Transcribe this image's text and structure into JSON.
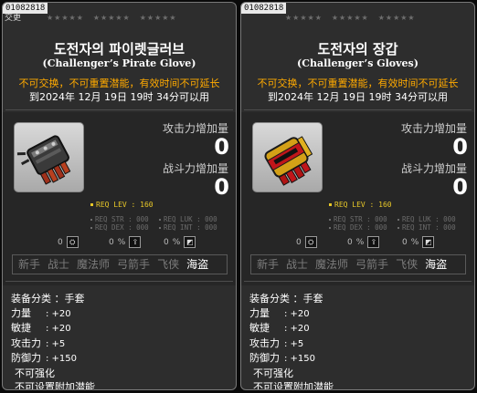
{
  "cards": [
    {
      "id": "01082818",
      "subtitle": "交更",
      "stars": [
        "★★★★★",
        "★★★★★",
        "★★★★★"
      ],
      "name_ko": "도전자의 파이렛글러브",
      "name_en": "(Challenger’s Pirate Glove)",
      "restriction": "不可交换，不可重置潜能，有效时间不可延长",
      "expiry": "到2024年 12月 19日 19时 34分可以用",
      "icon": "pirate-glove-icon",
      "attack_label": "攻击力增加量",
      "attack_value": "0",
      "combat_label": "战斗力增加量",
      "combat_value": "0",
      "req_lev": "REQ LEV : 160",
      "req_str": "REQ STR : 000",
      "req_luk": "REQ LUK : 000",
      "req_dex": "REQ DEX : 000",
      "req_int": "REQ INT : 000",
      "pct": [
        {
          "val": "0",
          "sym": "%"
        },
        {
          "val": "0",
          "sym": "%"
        },
        {
          "val": "0",
          "sym": "%"
        }
      ],
      "jobs": [
        "新手",
        "战士",
        "魔法师",
        "弓箭手",
        "飞侠",
        "海盗"
      ],
      "active_job": "海盗",
      "category_label": "装备分类",
      "category_value": "：手套",
      "stats": [
        {
          "label": "力量",
          "value": ": +20"
        },
        {
          "label": "敏捷",
          "value": ": +20"
        },
        {
          "label": "攻击力",
          "value": ": +5"
        },
        {
          "label": "防御力",
          "value": ": +150"
        }
      ],
      "note1": "不可强化",
      "note2": "不可设置附加潜能"
    },
    {
      "id": "01082818",
      "subtitle": "",
      "stars": [
        "★★★★★",
        "★★★★★",
        "★★★★★"
      ],
      "name_ko": "도전자의 장갑",
      "name_en": "(Challenger’s Gloves)",
      "restriction": "不可交换，不可重置潜能，有效时间不可延长",
      "expiry": "到2024年 12月 19日 19时 34分可以用",
      "icon": "challenger-glove-icon",
      "attack_label": "攻击力增加量",
      "attack_value": "0",
      "combat_label": "战斗力增加量",
      "combat_value": "0",
      "req_lev": "REQ LEV : 160",
      "req_str": "REQ STR : 000",
      "req_luk": "REQ LUK : 000",
      "req_dex": "REQ DEX : 000",
      "req_int": "REQ INT : 000",
      "pct": [
        {
          "val": "0",
          "sym": "%"
        },
        {
          "val": "0",
          "sym": "%"
        },
        {
          "val": "0",
          "sym": "%"
        }
      ],
      "jobs": [
        "新手",
        "战士",
        "魔法师",
        "弓箭手",
        "飞侠",
        "海盗"
      ],
      "active_job": "海盗",
      "category_label": "装备分类",
      "category_value": "：手套",
      "stats": [
        {
          "label": "力量",
          "value": ": +20"
        },
        {
          "label": "敏捷",
          "value": ": +20"
        },
        {
          "label": "攻击力",
          "value": ": +5"
        },
        {
          "label": "防御力",
          "value": ": +150"
        }
      ],
      "note1": "不可强化",
      "note2": "不可设置附加潜能"
    }
  ],
  "colors": {
    "warning": "#ffaa00",
    "req_level": "#e8c828",
    "req_dim": "#6c6c6c",
    "card_bg": "#2d2d2d"
  }
}
